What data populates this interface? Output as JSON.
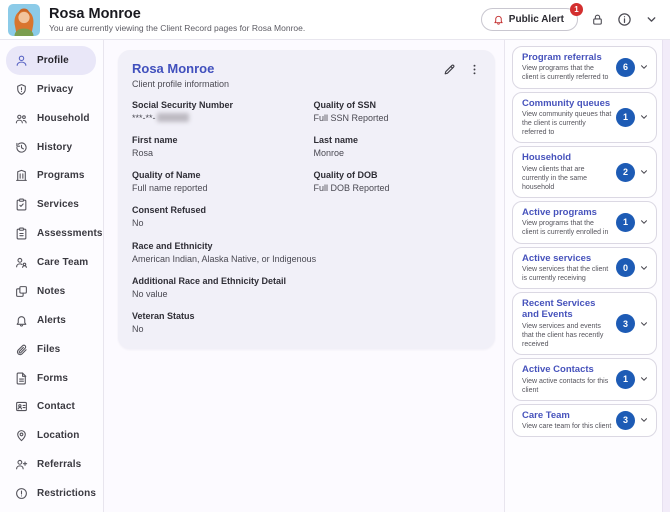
{
  "header": {
    "client_name": "Rosa Monroe",
    "context_note": "You are currently viewing the Client Record pages for Rosa Monroe.",
    "public_alert": {
      "label": "Public Alert",
      "count": "1"
    },
    "icons": [
      "alert-bell-icon",
      "lock-icon",
      "info-icon",
      "chevron-down-icon"
    ]
  },
  "sidebar": {
    "items": [
      {
        "label": "Profile",
        "icon": "profile-person-icon",
        "active": true
      },
      {
        "label": "Privacy",
        "icon": "privacy-shield-icon",
        "active": false
      },
      {
        "label": "Household",
        "icon": "household-people-icon",
        "active": false
      },
      {
        "label": "History",
        "icon": "history-clock-icon",
        "active": false
      },
      {
        "label": "Programs",
        "icon": "programs-building-icon",
        "active": false
      },
      {
        "label": "Services",
        "icon": "services-clipboard-icon",
        "active": false
      },
      {
        "label": "Assessments",
        "icon": "assessments-clipboard-icon",
        "active": false
      },
      {
        "label": "Care Team",
        "icon": "care-team-icon",
        "active": false
      },
      {
        "label": "Notes",
        "icon": "notes-copy-icon",
        "active": false
      },
      {
        "label": "Alerts",
        "icon": "alerts-bell-icon",
        "active": false
      },
      {
        "label": "Files",
        "icon": "files-paperclip-icon",
        "active": false
      },
      {
        "label": "Forms",
        "icon": "forms-document-icon",
        "active": false
      },
      {
        "label": "Contact",
        "icon": "contact-card-icon",
        "active": false
      },
      {
        "label": "Location",
        "icon": "location-pin-icon",
        "active": false
      },
      {
        "label": "Referrals",
        "icon": "referrals-person-plus-icon",
        "active": false
      },
      {
        "label": "Restrictions",
        "icon": "restrictions-alert-icon",
        "active": false
      }
    ]
  },
  "profile_card": {
    "title": "Rosa Monroe",
    "subtitle": "Client profile information",
    "fields": [
      {
        "left": {
          "label": "Social Security Number",
          "value": "***-**-"
        },
        "right": {
          "label": "Quality of SSN",
          "value": "Full SSN Reported"
        }
      },
      {
        "left": {
          "label": "First name",
          "value": "Rosa"
        },
        "right": {
          "label": "Last name",
          "value": "Monroe"
        }
      },
      {
        "left": {
          "label": "Quality of Name",
          "value": "Full name reported"
        },
        "right": {
          "label": "Quality of DOB",
          "value": "Full DOB Reported"
        }
      },
      {
        "left": {
          "label": "Consent Refused",
          "value": "No"
        }
      },
      {
        "left": {
          "label": "Race and Ethnicity",
          "value": "American Indian, Alaska Native, or Indigenous"
        }
      },
      {
        "left": {
          "label": "Additional Race and Ethnicity Detail",
          "value": "No value"
        }
      },
      {
        "left": {
          "label": "Veteran Status",
          "value": "No"
        }
      }
    ]
  },
  "summary_panel": {
    "cards": [
      {
        "title": "Program referrals",
        "description": "View programs that the client is currently referred to",
        "count": "6"
      },
      {
        "title": "Community queues",
        "description": "View community queues that the client is currently referred to",
        "count": "1"
      },
      {
        "title": "Household",
        "description": "View clients that are currently in the same household",
        "count": "2"
      },
      {
        "title": "Active programs",
        "description": "View programs that the client is currently enrolled in",
        "count": "1"
      },
      {
        "title": "Active services",
        "description": "View services that the client is currently receiving",
        "count": "0"
      },
      {
        "title": "Recent Services and Events",
        "description": "View services and events that the client has recently received",
        "count": "3"
      },
      {
        "title": "Active Contacts",
        "description": "View active contacts for this client",
        "count": "1"
      },
      {
        "title": "Care Team",
        "description": "View care team for this client",
        "count": "3"
      }
    ]
  },
  "colors": {
    "accent_indigo": "#4150bd",
    "badge_blue": "#1d5bb5",
    "alert_red": "#d32f2f",
    "card_bg": "#f1f0f8"
  }
}
